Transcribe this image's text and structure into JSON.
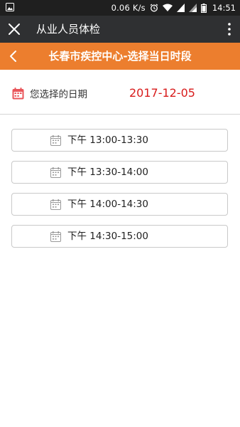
{
  "status_bar": {
    "net_speed": "0.06 K/s",
    "time": "14:51",
    "icons": [
      "image-icon",
      "alarm-icon",
      "wifi-icon",
      "signal-icon",
      "signal-icon",
      "battery-icon"
    ]
  },
  "title_bar": {
    "title": "从业人员体检",
    "icons": [
      "close-icon",
      "more-icon"
    ]
  },
  "header": {
    "title": "长春市疾控中心-选择当日时段",
    "color": "#ec7e2e",
    "icon": "back-icon"
  },
  "date_row": {
    "label": "您选择的日期",
    "value": "2017-12-05",
    "value_color": "#d81b1b",
    "icon": "calendar-icon"
  },
  "slots": [
    {
      "label": "下午 13:00-13:30"
    },
    {
      "label": "下午 13:30-14:00"
    },
    {
      "label": "下午 14:00-14:30"
    },
    {
      "label": "下午 14:30-15:00"
    }
  ]
}
